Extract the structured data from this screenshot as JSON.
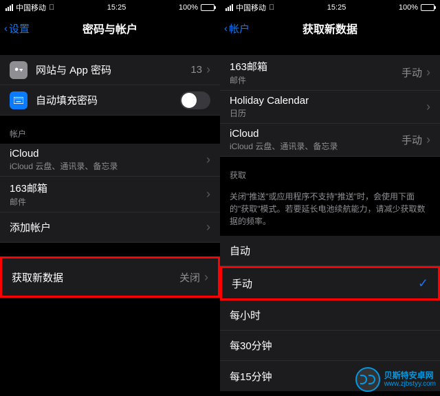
{
  "status": {
    "carrier": "中国移动",
    "time": "15:25",
    "battery": "100%"
  },
  "left": {
    "back": "设置",
    "title": "密码与帐户",
    "rows": {
      "app_pw": {
        "label": "网站与 App 密码",
        "value": "13"
      },
      "autofill": {
        "label": "自动填充密码"
      }
    },
    "accounts_header": "帐户",
    "accounts": [
      {
        "label": "iCloud",
        "sub": "iCloud 云盘、通讯录、备忘录"
      },
      {
        "label": "163邮箱",
        "sub": "邮件"
      },
      {
        "label": "添加帐户",
        "sub": ""
      }
    ],
    "fetch": {
      "label": "获取新数据",
      "value": "关闭"
    }
  },
  "right": {
    "back": "帐户",
    "title": "获取新数据",
    "accounts": [
      {
        "label": "163邮箱",
        "sub": "邮件",
        "value": "手动"
      },
      {
        "label": "Holiday Calendar",
        "sub": "日历",
        "value": ""
      },
      {
        "label": "iCloud",
        "sub": "iCloud 云盘、通讯录、备忘录",
        "value": "手动"
      }
    ],
    "fetch_header": "获取",
    "fetch_footer": "关闭\"推送\"或应用程序不支持\"推送\"时，会使用下面的\"获取\"模式。若要延长电池续航能力，请减少获取数据的频率。",
    "options": [
      "自动",
      "手动",
      "每小时",
      "每30分钟",
      "每15分钟"
    ],
    "selected_index": 1
  },
  "watermark": {
    "name": "贝斯特安卓网",
    "url": "www.zjbstyy.com"
  }
}
